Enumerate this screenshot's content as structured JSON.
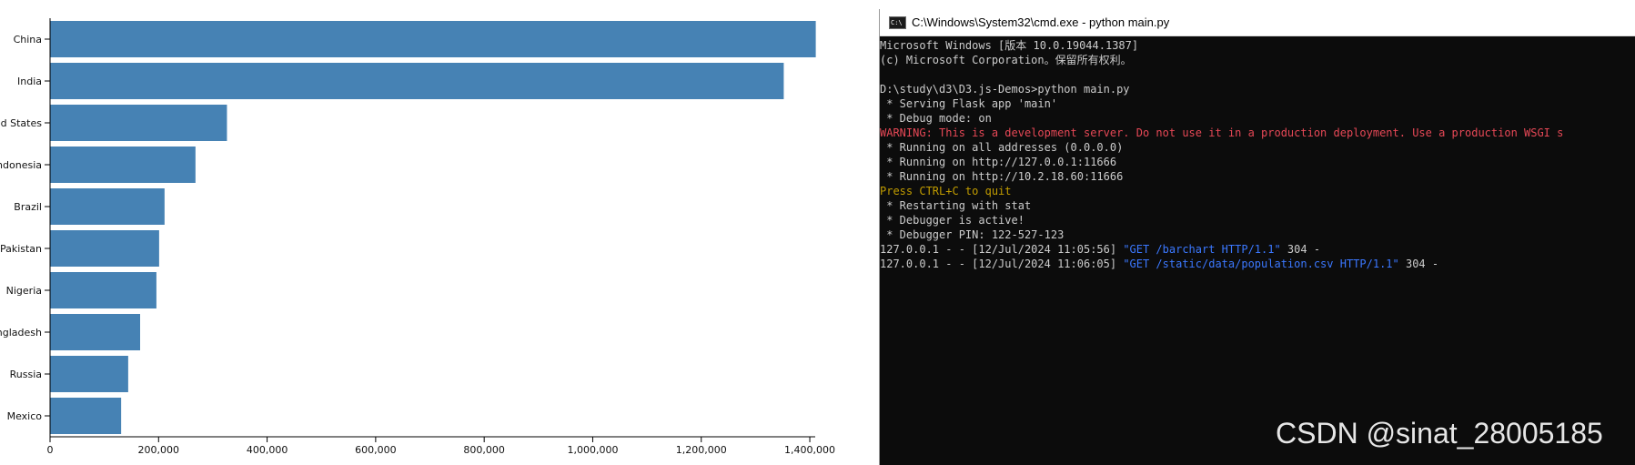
{
  "chart_data": {
    "type": "bar",
    "orientation": "horizontal",
    "categories": [
      "China",
      "India",
      "United States",
      "Indonesia",
      "Brazil",
      "Pakistan",
      "Nigeria",
      "Bangladesh",
      "Russia",
      "Mexico"
    ],
    "values": [
      1411000,
      1352000,
      326000,
      268000,
      211000,
      201000,
      196000,
      166000,
      144000,
      131000
    ],
    "xlim": [
      0,
      1410000
    ],
    "xticks": [
      0,
      200000,
      400000,
      600000,
      800000,
      1000000,
      1200000,
      1400000
    ],
    "xtick_labels": [
      "0",
      "200,000",
      "400,000",
      "600,000",
      "800,000",
      "1,000,000",
      "1,200,000",
      "1,400,000"
    ],
    "bar_color": "#4682b4",
    "grid": false
  },
  "cmd": {
    "title": "C:\\Windows\\System32\\cmd.exe - python  main.py",
    "icon": "cmd-icon",
    "icon_label": "C:\\",
    "lines": [
      {
        "text": "Microsoft Windows [版本 10.0.19044.1387]",
        "color": "normal"
      },
      {
        "text": "(c) Microsoft Corporation。保留所有权利。",
        "color": "normal"
      },
      {
        "text": "",
        "color": "normal"
      },
      {
        "text": "D:\\study\\d3\\D3.js-Demos>python main.py",
        "color": "normal"
      },
      {
        "text": " * Serving Flask app 'main'",
        "color": "normal"
      },
      {
        "text": " * Debug mode: on",
        "color": "normal"
      },
      {
        "text": "WARNING: This is a development server. Do not use it in a production deployment. Use a production WSGI s",
        "color": "warn"
      },
      {
        "text": " * Running on all addresses (0.0.0.0)",
        "color": "normal"
      },
      {
        "text": " * Running on http://127.0.0.1:11666",
        "color": "normal"
      },
      {
        "text": " * Running on http://10.2.18.60:11666",
        "color": "normal"
      },
      {
        "text": "Press CTRL+C to quit",
        "color": "quit"
      },
      {
        "text": " * Restarting with stat",
        "color": "normal"
      },
      {
        "text": " * Debugger is active!",
        "color": "normal"
      },
      {
        "text": " * Debugger PIN: 122-527-123",
        "color": "normal"
      }
    ],
    "requests": [
      {
        "prefix": "127.0.0.1 - - [12/Jul/2024 11:05:56] ",
        "request": "\"GET /barchart HTTP/1.1\"",
        "suffix": " 304 -"
      },
      {
        "prefix": "127.0.0.1 - - [12/Jul/2024 11:06:05] ",
        "request": "\"GET /static/data/population.csv HTTP/1.1\"",
        "suffix": " 304 -"
      }
    ]
  },
  "watermark": "CSDN @sinat_28005185"
}
